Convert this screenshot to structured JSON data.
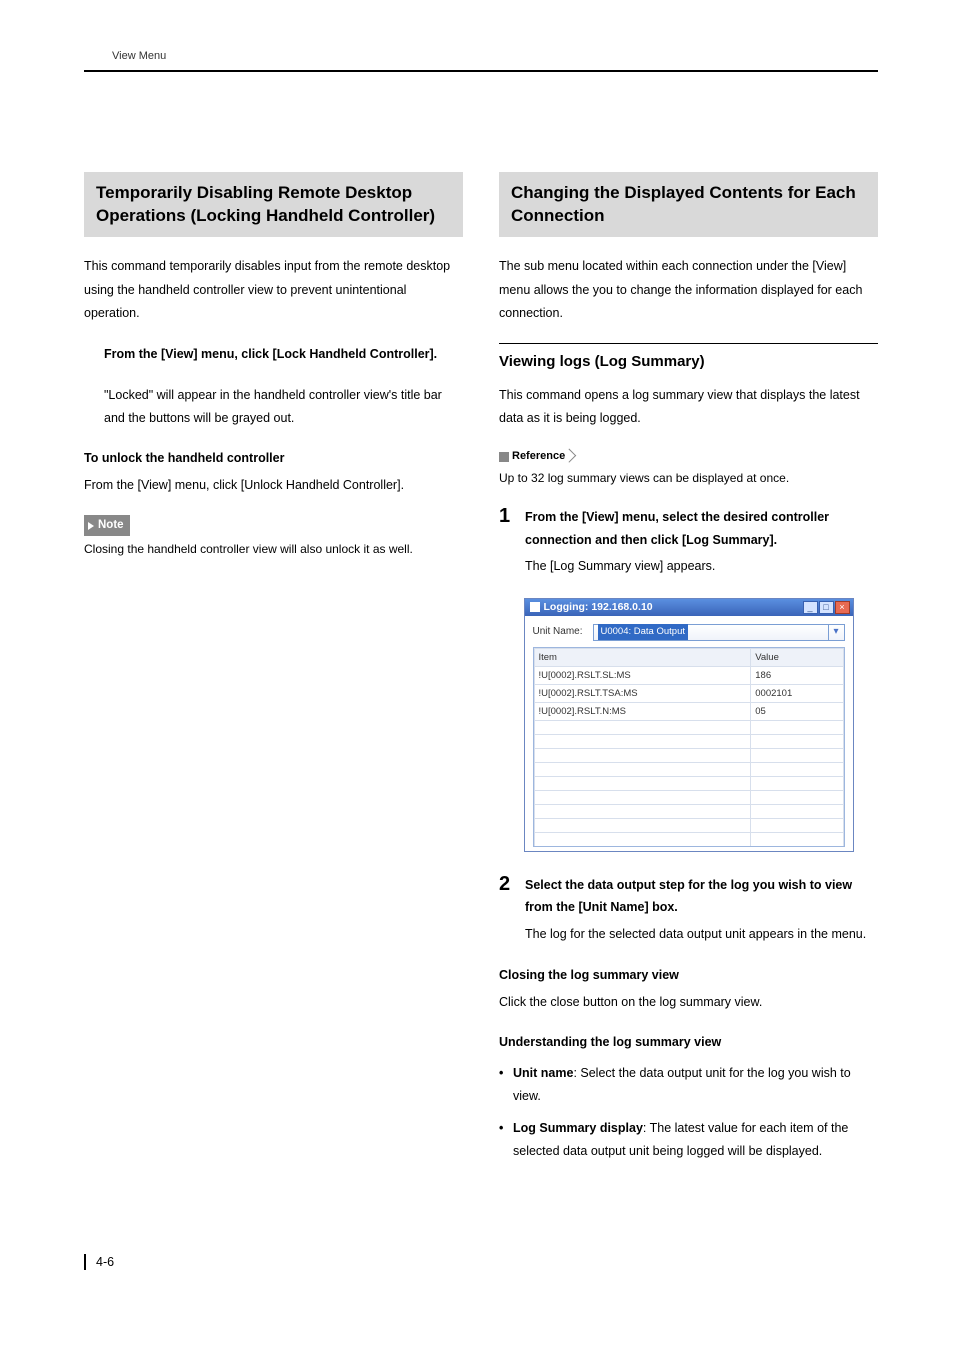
{
  "header": "View Menu",
  "page_number": "4-6",
  "left": {
    "title": "Temporarily Disabling Remote Desktop Operations (Locking Handheld Controller)",
    "intro": "This command temporarily disables input from the remote desktop using the handheld controller view to prevent unintentional operation.",
    "instr_head": "From the [View] menu, click [Lock Handheld Controller].",
    "instr_body": "\"Locked\" will appear in the handheld controller view's title bar and the buttons will be grayed out.",
    "unlock_head": "To unlock the handheld controller",
    "unlock_body": "From the [View] menu, click [Unlock Handheld Controller].",
    "note_label": "Note",
    "note_text": "Closing the handheld controller view will also unlock it as well."
  },
  "right": {
    "title": "Changing the Displayed Contents for Each Connection",
    "intro": "The sub menu located within each connection under the [View] menu allows the you to change the information displayed for each connection.",
    "sub_head": "Viewing logs (Log Summary)",
    "sub_intro": "This command opens a log summary view that displays the latest data as it is being logged.",
    "ref_label": "Reference",
    "ref_text": "Up to 32 log summary views can be displayed at once.",
    "steps": [
      {
        "num": "1",
        "bold": "From the [View] menu, select the desired controller connection and then click [Log Summary].",
        "plain": "The [Log Summary view] appears."
      },
      {
        "num": "2",
        "bold": "Select the data output step for the log you wish to view from the [Unit Name] box.",
        "plain": "The log for the selected data output unit appears in the menu."
      }
    ],
    "window": {
      "title": "Logging: 192.168.0.10",
      "unit_label": "Unit Name:",
      "unit_value": "U0004: Data Output",
      "cols": [
        "Item",
        "Value"
      ],
      "rows": [
        [
          "!U[0002].RSLT.SL:MS",
          "186"
        ],
        [
          "!U[0002].RSLT.TSA:MS",
          "0002101"
        ],
        [
          "!U[0002].RSLT.N:MS",
          "05"
        ]
      ]
    },
    "closing_head": "Closing the log summary view",
    "closing_body": "Click the close button on the log summary view.",
    "understand_head": "Understanding the log summary view",
    "bullets": [
      {
        "term": "Unit name",
        "text": ": Select the data output unit for the log you wish to view."
      },
      {
        "term": "Log Summary display",
        "text": ": The latest value for each item of the selected data output unit being logged will be displayed."
      }
    ]
  }
}
